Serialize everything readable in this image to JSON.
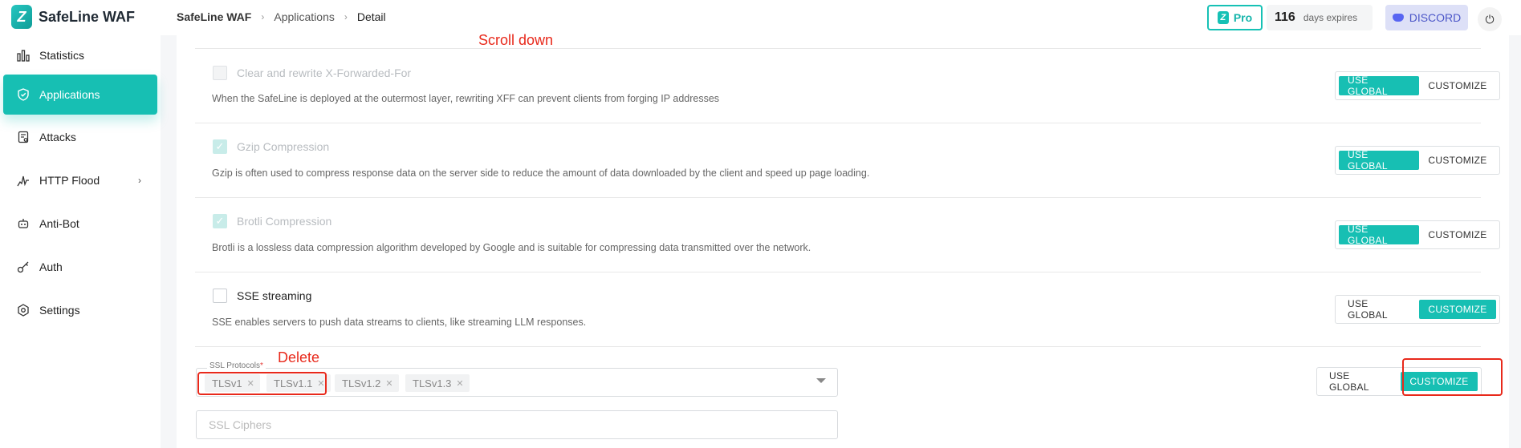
{
  "header": {
    "brand": "SafeLine WAF",
    "breadcrumb": [
      "SafeLine WAF",
      "Applications",
      "Detail"
    ],
    "pro_label": "Pro",
    "days_count": "116",
    "days_label": "days expires",
    "discord_label": "DISCORD"
  },
  "sidebar": {
    "items": [
      {
        "label": "Statistics",
        "icon": "bar-chart-icon"
      },
      {
        "label": "Applications",
        "icon": "shield-icon",
        "active": true
      },
      {
        "label": "Attacks",
        "icon": "clipboard-icon"
      },
      {
        "label": "HTTP Flood",
        "icon": "flood-chart-icon",
        "has_submenu": true
      },
      {
        "label": "Anti-Bot",
        "icon": "robot-icon"
      },
      {
        "label": "Auth",
        "icon": "key-icon"
      },
      {
        "label": "Settings",
        "icon": "gear-icon"
      }
    ]
  },
  "settings": [
    {
      "title": "Clear and rewrite X-Forwarded-For",
      "desc": "When the SafeLine is deployed at the outermost layer, rewriting XFF can prevent clients from forging IP addresses",
      "checked": false,
      "disabled": true,
      "mode": "global"
    },
    {
      "title": "Gzip Compression",
      "desc": "Gzip is often used to compress response data on the server side to reduce the amount of data downloaded by the client and speed up page loading.",
      "checked": true,
      "disabled": true,
      "mode": "global"
    },
    {
      "title": "Brotli Compression",
      "desc": "Brotli is a lossless data compression algorithm developed by Google and is suitable for compressing data transmitted over the network.",
      "checked": true,
      "disabled": true,
      "mode": "global"
    },
    {
      "title": "SSE streaming",
      "desc": "SSE enables servers to push data streams to clients, like streaming LLM responses.",
      "checked": false,
      "disabled": false,
      "mode": "customize"
    }
  ],
  "toggle": {
    "global_label": "USE GLOBAL",
    "customize_label": "CUSTOMIZE"
  },
  "ssl": {
    "protocols_label": "SSL Protocols",
    "required_mark": "*",
    "protocols": [
      "TLSv1",
      "TLSv1.1",
      "TLSv1.2",
      "TLSv1.3"
    ],
    "ciphers_placeholder": "SSL Ciphers",
    "mode": "customize"
  },
  "annotations": {
    "scroll": "Scroll down",
    "delete": "Delete"
  },
  "colors": {
    "accent": "#17bfb3",
    "annotation": "#e8291b"
  }
}
